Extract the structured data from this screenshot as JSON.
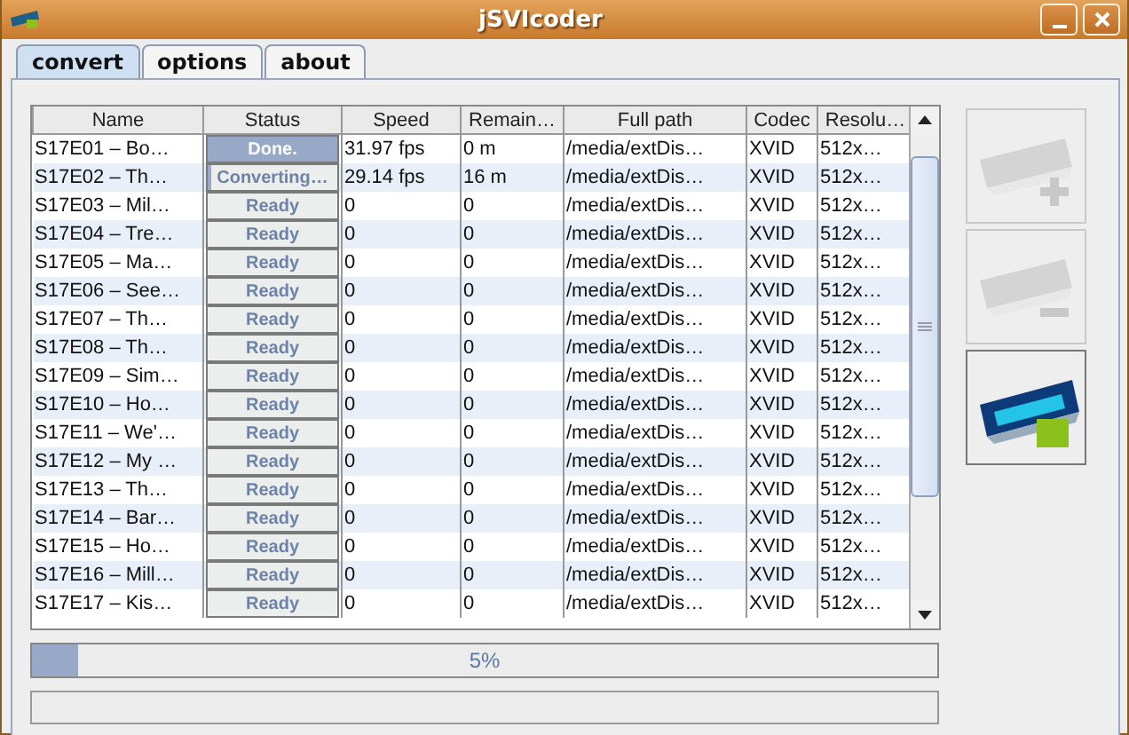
{
  "window": {
    "title": "jSVIcoder"
  },
  "tabs": [
    {
      "label": "convert",
      "selected": true
    },
    {
      "label": "options",
      "selected": false
    },
    {
      "label": "about",
      "selected": false
    }
  ],
  "table": {
    "columns": [
      "Name",
      "Status",
      "Speed",
      "Remain…",
      "Full path",
      "Codec",
      "Resolu…"
    ],
    "rows": [
      {
        "name": "S17E01 – Bo…",
        "status": {
          "text": "Done.",
          "level": 1
        },
        "speed": "31.97 fps",
        "remaining": "0 m",
        "path": "/media/extDis…",
        "codec": "XVID",
        "resolution": "512x…"
      },
      {
        "name": "S17E02 – Th…",
        "status": {
          "text": "Converting…",
          "level": 0.03
        },
        "speed": "29.14 fps",
        "remaining": "16 m",
        "path": "/media/extDis…",
        "codec": "XVID",
        "resolution": "512x…"
      },
      {
        "name": "S17E03 – Mil…",
        "status": {
          "text": "Ready",
          "level": 0
        },
        "speed": "0",
        "remaining": "0",
        "path": "/media/extDis…",
        "codec": "XVID",
        "resolution": "512x…"
      },
      {
        "name": "S17E04 – Tre…",
        "status": {
          "text": "Ready",
          "level": 0
        },
        "speed": "0",
        "remaining": "0",
        "path": "/media/extDis…",
        "codec": "XVID",
        "resolution": "512x…"
      },
      {
        "name": "S17E05 – Ma…",
        "status": {
          "text": "Ready",
          "level": 0
        },
        "speed": "0",
        "remaining": "0",
        "path": "/media/extDis…",
        "codec": "XVID",
        "resolution": "512x…"
      },
      {
        "name": "S17E06 – See…",
        "status": {
          "text": "Ready",
          "level": 0
        },
        "speed": "0",
        "remaining": "0",
        "path": "/media/extDis…",
        "codec": "XVID",
        "resolution": "512x…"
      },
      {
        "name": "S17E07 – Th…",
        "status": {
          "text": "Ready",
          "level": 0
        },
        "speed": "0",
        "remaining": "0",
        "path": "/media/extDis…",
        "codec": "XVID",
        "resolution": "512x…"
      },
      {
        "name": "S17E08 – Th…",
        "status": {
          "text": "Ready",
          "level": 0
        },
        "speed": "0",
        "remaining": "0",
        "path": "/media/extDis…",
        "codec": "XVID",
        "resolution": "512x…"
      },
      {
        "name": "S17E09 – Sim…",
        "status": {
          "text": "Ready",
          "level": 0
        },
        "speed": "0",
        "remaining": "0",
        "path": "/media/extDis…",
        "codec": "XVID",
        "resolution": "512x…"
      },
      {
        "name": "S17E10 – Ho…",
        "status": {
          "text": "Ready",
          "level": 0
        },
        "speed": "0",
        "remaining": "0",
        "path": "/media/extDis…",
        "codec": "XVID",
        "resolution": "512x…"
      },
      {
        "name": "S17E11 – We'…",
        "status": {
          "text": "Ready",
          "level": 0
        },
        "speed": "0",
        "remaining": "0",
        "path": "/media/extDis…",
        "codec": "XVID",
        "resolution": "512x…"
      },
      {
        "name": "S17E12 – My …",
        "status": {
          "text": "Ready",
          "level": 0
        },
        "speed": "0",
        "remaining": "0",
        "path": "/media/extDis…",
        "codec": "XVID",
        "resolution": "512x…"
      },
      {
        "name": "S17E13 – Th…",
        "status": {
          "text": "Ready",
          "level": 0
        },
        "speed": "0",
        "remaining": "0",
        "path": "/media/extDis…",
        "codec": "XVID",
        "resolution": "512x…"
      },
      {
        "name": "S17E14 – Bar…",
        "status": {
          "text": "Ready",
          "level": 0
        },
        "speed": "0",
        "remaining": "0",
        "path": "/media/extDis…",
        "codec": "XVID",
        "resolution": "512x…"
      },
      {
        "name": "S17E15 – Ho…",
        "status": {
          "text": "Ready",
          "level": 0
        },
        "speed": "0",
        "remaining": "0",
        "path": "/media/extDis…",
        "codec": "XVID",
        "resolution": "512x…"
      },
      {
        "name": "S17E16 – Mill…",
        "status": {
          "text": "Ready",
          "level": 0
        },
        "speed": "0",
        "remaining": "0",
        "path": "/media/extDis…",
        "codec": "XVID",
        "resolution": "512x…"
      },
      {
        "name": "S17E17 – Kis…",
        "status": {
          "text": "Ready",
          "level": 0
        },
        "speed": "0",
        "remaining": "0",
        "path": "/media/extDis…",
        "codec": "XVID",
        "resolution": "512x…"
      }
    ]
  },
  "side_buttons": [
    {
      "kind": "add",
      "disabled": true
    },
    {
      "kind": "remove",
      "disabled": true
    },
    {
      "kind": "convert",
      "disabled": false
    }
  ],
  "progress": {
    "level": 0.05,
    "label": "5%"
  }
}
